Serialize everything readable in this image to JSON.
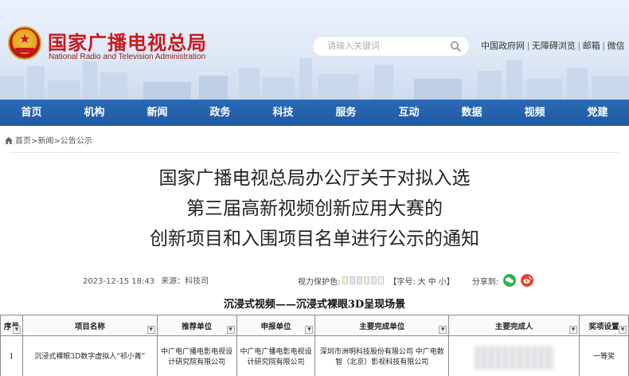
{
  "header": {
    "title_cn": "国家广播电视总局",
    "title_en": "National Radio and Television Administration",
    "emblem_icon": "national-emblem",
    "search_placeholder": "请输入关键词",
    "top_links": [
      "中国政府网",
      "无障碍浏览",
      "邮箱",
      "微信"
    ]
  },
  "nav": {
    "items": [
      "首页",
      "机构",
      "新闻",
      "政务",
      "科技",
      "服务",
      "互动",
      "数据",
      "视频",
      "党建"
    ]
  },
  "breadcrumb": {
    "items": [
      "首页",
      "新闻",
      "公告公示"
    ],
    "separator": ">"
  },
  "article": {
    "title_lines": [
      "国家广播电视总局办公厅关于对拟入选",
      "第三届高新视频创新应用大赛的",
      "创新项目和入围项目名单进行公示的通知"
    ],
    "datetime": "2023-12-15 18:43",
    "source": "来源：科技司",
    "eye_protection_label": "视力保护色:",
    "eye_colors": [
      "#f9f0c8",
      "#dbe9f7",
      "#e7e0f3",
      "#e3f1dd",
      "#f2e2ea",
      "#eeeeee"
    ],
    "font_size_label": "【字号:",
    "font_sizes": [
      "大",
      "中",
      "小"
    ],
    "font_size_close": "】",
    "share_label": "分享到:",
    "share_icons": [
      "wechat-icon",
      "weibo-icon"
    ]
  },
  "table": {
    "heading": "沉浸式视频——沉浸式裸眼3D呈现场景",
    "columns": [
      "序号",
      "项目名称",
      "推荐单位",
      "申报单位",
      "主要完成单位",
      "主要完成人",
      "奖项设置"
    ],
    "rows": [
      {
        "index": "1",
        "project": "沉浸式裸眼3D数字虚拟人“祁小菁”",
        "recommender": "中广电广播电影电视设计研究院有限公司",
        "applicant": "中广电广播电影电视设计研究院有限公司",
        "completing_units": "深圳市洲明科技股份有限公司 中广电数智（北京）影视科技有限公司",
        "award": "一等奖"
      }
    ]
  }
}
